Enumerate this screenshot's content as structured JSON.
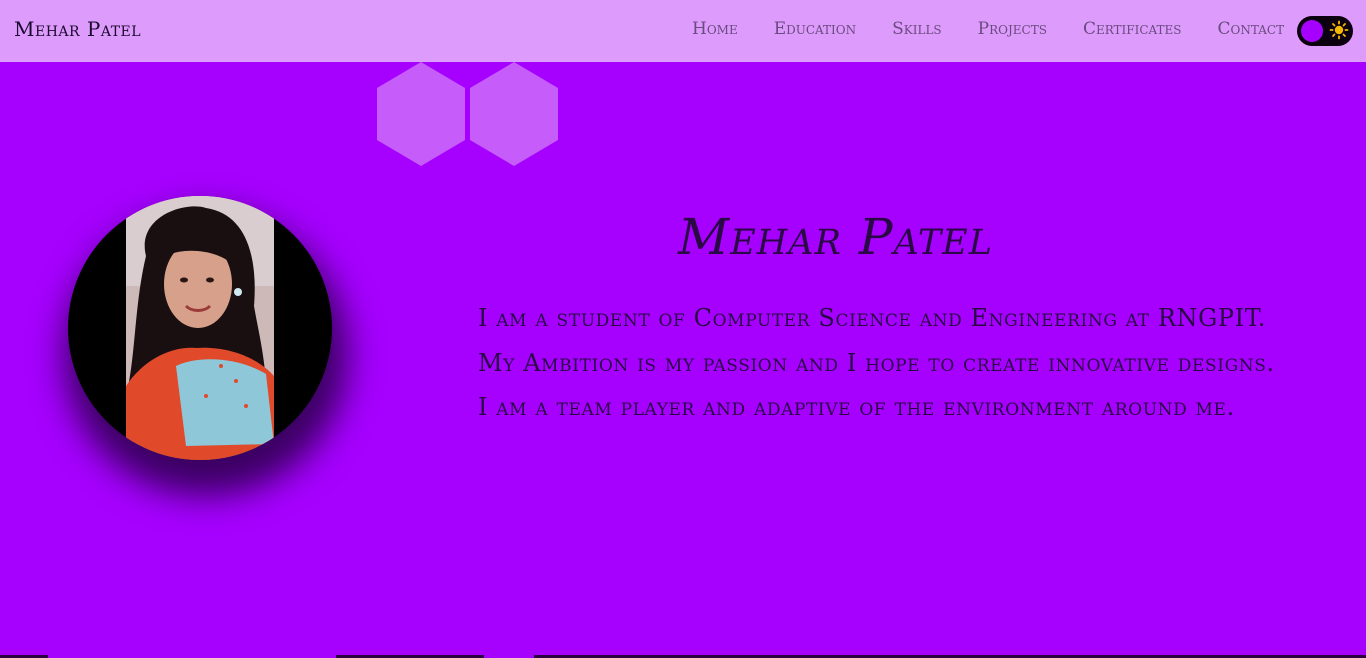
{
  "brand": {
    "name": "Mehar Patel"
  },
  "nav": {
    "items": [
      {
        "label": "Home"
      },
      {
        "label": "Education"
      },
      {
        "label": "Skills"
      },
      {
        "label": "Projects"
      },
      {
        "label": "Certificates"
      },
      {
        "label": "Contact"
      }
    ]
  },
  "theme_toggle": {
    "icon": "sun-icon",
    "state": "dark"
  },
  "hero": {
    "name": "Mehar Patel",
    "bio": [
      "I am a student of Computer Science and Engineering at RNGPIT.",
      "My Ambition is my passion and I hope to create innovative designs.",
      "I am a team player and adaptive of the environment around me."
    ]
  },
  "colors": {
    "background": "#a600ff",
    "navbar": "#dd9bfb",
    "text": "#2a0845",
    "hexagon": "#c65cf9"
  }
}
